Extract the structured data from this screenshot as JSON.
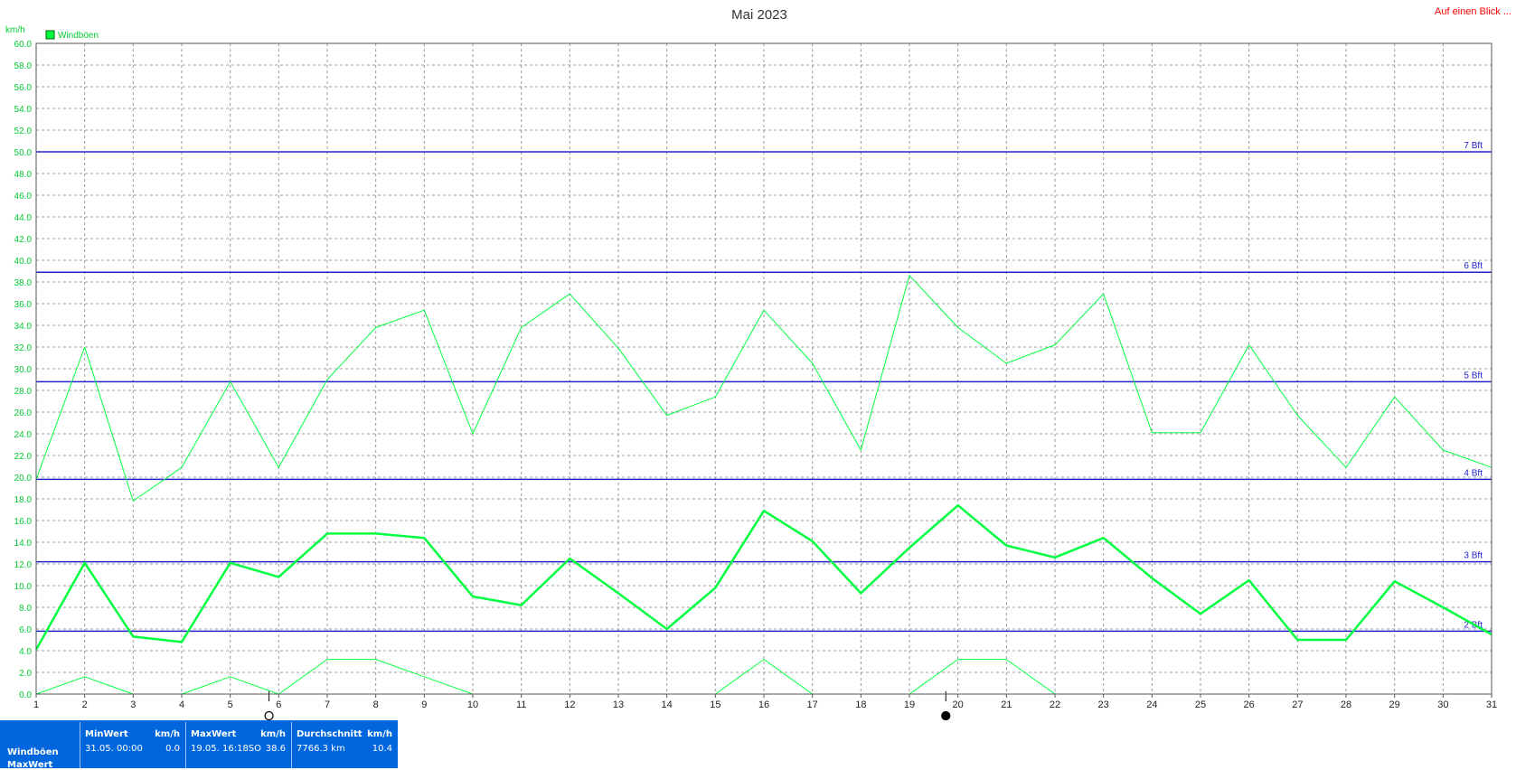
{
  "header": {
    "title": "Mai 2023",
    "top_right_link": "Auf einen Blick ...",
    "unit_label": "km/h",
    "legend_label": "Windböen"
  },
  "colors": {
    "series": "#00ff40",
    "beaufort_lines": "#2222cc",
    "axis_text": "#00cc33",
    "link": "#ff0000",
    "footer_bg": "#0066dd"
  },
  "chart_data": {
    "type": "line",
    "title": "Mai 2023",
    "ylabel": "km/h",
    "ylim": [
      0,
      60
    ],
    "ytick_step": 2,
    "x": [
      1,
      2,
      3,
      4,
      5,
      6,
      7,
      8,
      9,
      10,
      11,
      12,
      13,
      14,
      15,
      16,
      17,
      18,
      19,
      20,
      21,
      22,
      23,
      24,
      25,
      26,
      27,
      28,
      29,
      30,
      31
    ],
    "legend": [
      "Windböen"
    ],
    "grid": true,
    "series": [
      {
        "name": "Windböen max",
        "values": [
          19.8,
          32.0,
          17.8,
          20.9,
          28.8,
          20.9,
          29.0,
          33.8,
          35.4,
          24.0,
          33.8,
          36.9,
          31.9,
          25.7,
          27.4,
          35.4,
          30.5,
          22.5,
          38.6,
          33.8,
          30.5,
          32.2,
          36.9,
          24.1,
          24.1,
          32.2,
          25.7,
          20.9,
          27.4,
          22.5,
          20.9
        ]
      },
      {
        "name": "Windböen avg",
        "values": [
          4.1,
          12.1,
          5.3,
          4.8,
          12.1,
          10.8,
          14.8,
          14.8,
          14.4,
          9.0,
          8.2,
          12.5,
          9.3,
          6.0,
          9.8,
          16.9,
          14.1,
          9.3,
          13.5,
          17.4,
          13.7,
          12.6,
          14.4,
          10.7,
          7.4,
          10.5,
          5.0,
          5.0,
          10.4,
          8.0,
          5.5
        ]
      },
      {
        "name": "Windböen min",
        "values": [
          0.0,
          1.6,
          0.0,
          0.0,
          1.6,
          0.0,
          3.2,
          3.2,
          1.6,
          0.0,
          null,
          null,
          null,
          null,
          0.0,
          3.2,
          0.0,
          null,
          0.0,
          3.2,
          3.2,
          0.0,
          null,
          null,
          null,
          null,
          null,
          null,
          null,
          null,
          null
        ]
      }
    ],
    "beaufort": [
      {
        "label": "2 Bft",
        "value": 5.8
      },
      {
        "label": "3 Bft",
        "value": 12.2
      },
      {
        "label": "4 Bft",
        "value": 19.8
      },
      {
        "label": "5 Bft",
        "value": 28.8
      },
      {
        "label": "6 Bft",
        "value": 38.9
      },
      {
        "label": "7 Bft",
        "value": 50.0
      }
    ],
    "markers": [
      {
        "type": "moon-full",
        "day": 5.8
      },
      {
        "type": "moon-new",
        "day": 19.75
      }
    ]
  },
  "footer": {
    "row_labels": [
      "Windböen",
      "MaxWert"
    ],
    "stats": [
      {
        "head": "MinWert",
        "unit": "km/h",
        "time": "31.05.  00:00",
        "value": "0.0"
      },
      {
        "head": "MaxWert",
        "unit": "km/h",
        "time": "19.05.  16:18SO",
        "value": "38.6"
      },
      {
        "head": "Durchschnitt",
        "unit": "km/h",
        "time": "7766.3 km",
        "value": "10.4"
      }
    ]
  }
}
